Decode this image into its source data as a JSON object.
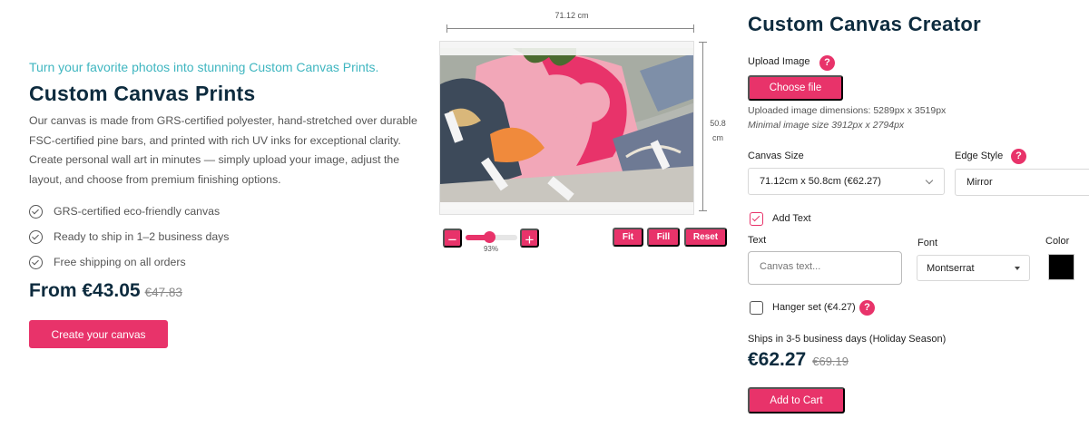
{
  "product": {
    "tagline": "Turn your favorite photos into stunning Custom Canvas Prints.",
    "title": "Custom Canvas Prints",
    "description": "Our canvas is made from GRS-certified polyester, hand-stretched over durable FSC-certified pine bars, and printed with rich UV inks for exceptional clarity. Create personal wall art in minutes — simply upload your image, adjust the layout, and choose from premium finishing options.",
    "features": [
      "GRS-certified eco-friendly canvas",
      "Ready to ship in 1–2 business days",
      "Free shipping on all orders"
    ],
    "price": "From €43.05",
    "old_price": "€47.83",
    "cta_label": "Create your canvas"
  },
  "preview": {
    "width_label": "71.12 cm",
    "height_value": "50.8",
    "height_unit": "cm",
    "zoom_percent": 93,
    "zoom_label": "93%",
    "zoom_minus": "−",
    "zoom_plus": "+",
    "fit_label": "Fit",
    "fill_label": "Fill",
    "reset_label": "Reset"
  },
  "creator": {
    "title": "Custom Canvas Creator",
    "upload_label": "Upload Image",
    "help_glyph": "?",
    "choose_file_label": "Choose file",
    "uploaded_dims": "Uploaded image dimensions: 5289px x 3519px",
    "min_dims": "Minimal image size 3912px x 2794px",
    "canvas_size_label": "Canvas Size",
    "canvas_size_value": "71.12cm x 50.8cm (€62.27)",
    "edge_style_label": "Edge Style",
    "edge_style_value": "Mirror",
    "add_text_label": "Add Text",
    "add_text_checked": true,
    "text_label": "Text",
    "text_placeholder": "Canvas text...",
    "font_label": "Font",
    "font_value": "Montserrat",
    "color_label": "Color",
    "color_value": "#000000",
    "hanger_label": "Hanger set (€4.27)",
    "hanger_checked": false,
    "shipping_note": "Ships in 3-5 business days (Holiday Season)",
    "total_price": "€62.27",
    "total_old_price": "€69.19",
    "add_to_cart_label": "Add to Cart"
  },
  "colors": {
    "accent": "#e8336a",
    "heading": "#0d2b3e",
    "tagline": "#3fb6c0"
  },
  "icons": {
    "feature_check": "check-circle-icon",
    "help": "question-circle-icon",
    "dropdown": "chevron-down-icon"
  }
}
